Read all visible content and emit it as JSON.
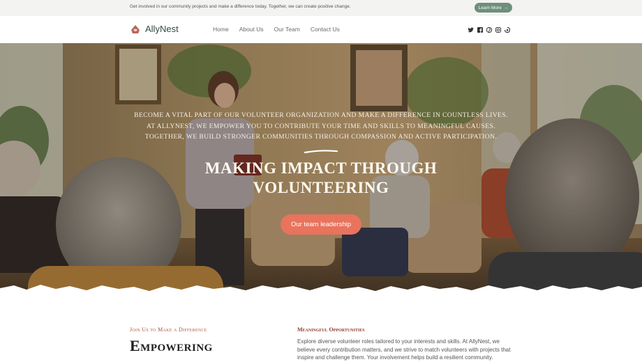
{
  "topbar": {
    "message": "Get involved in our community projects and make a difference today. Together, we can create positive change.",
    "cta_label": "Learn More",
    "cta_icon": "arrow-right-icon"
  },
  "header": {
    "brand": "AllyNest",
    "nav": [
      "Home",
      "About Us",
      "Our Team",
      "Contact Us"
    ],
    "social_icons": [
      "twitter-icon",
      "facebook-icon",
      "pinterest-icon",
      "instagram-icon",
      "threads-icon"
    ]
  },
  "hero": {
    "paragraph": "Become a vital part of our volunteer organization and make a difference in countless lives. At AllyNest, we empower you to contribute your time and skills to meaningful causes. Together, we build stronger communities through compassion and active participation.",
    "title_line1": "MAKING IMPACT THROUGH",
    "title_line2": "VOLUNTEERING",
    "button_label": "Our team leadership"
  },
  "intro": {
    "eyebrow": "Join Us to Make a Difference",
    "heading": "Empowering",
    "subheading": "Meaningful Opportunities",
    "body": "Explore diverse volunteer roles tailored to your interests and skills. At AllyNest, we believe every contribution matters, and we strive to match volunteers with projects that inspire and challenge them. Your involvement helps build a resilient community."
  },
  "colors": {
    "accent_green": "#6d8f7b",
    "button_coral": "#e9735d",
    "eyebrow_red": "#b0533f"
  }
}
